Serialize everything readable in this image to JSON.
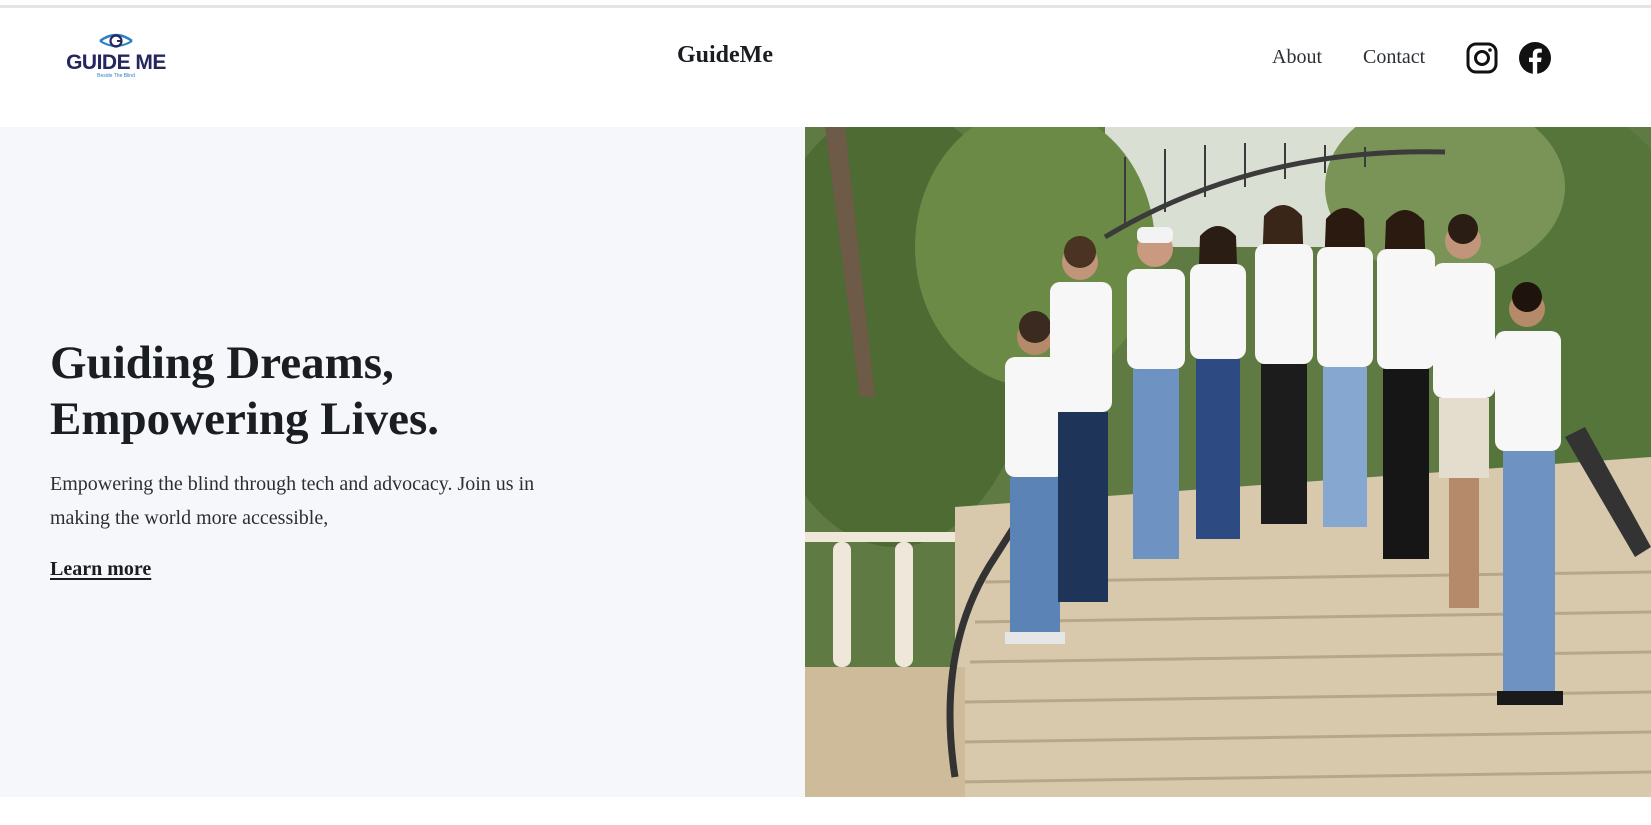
{
  "header": {
    "logo": {
      "text": "GUIDE ME",
      "tagline": "Beside The Blind",
      "icon": "eye-icon",
      "color": "#23275e",
      "accent": "#2a7fc4"
    },
    "brand": "GuideMe",
    "nav": [
      {
        "label": "About"
      },
      {
        "label": "Contact"
      }
    ],
    "social": [
      {
        "icon": "instagram-icon"
      },
      {
        "icon": "facebook-icon"
      }
    ]
  },
  "hero": {
    "title_line1": "Guiding Dreams,",
    "title_line2": "Empowering Lives.",
    "description": "Empowering the blind through tech and advocacy. Join us in making the world more accessible,",
    "cta_label": "Learn more",
    "image": {
      "subject": "group-photo-icon",
      "background": "#f6f7fa"
    }
  }
}
